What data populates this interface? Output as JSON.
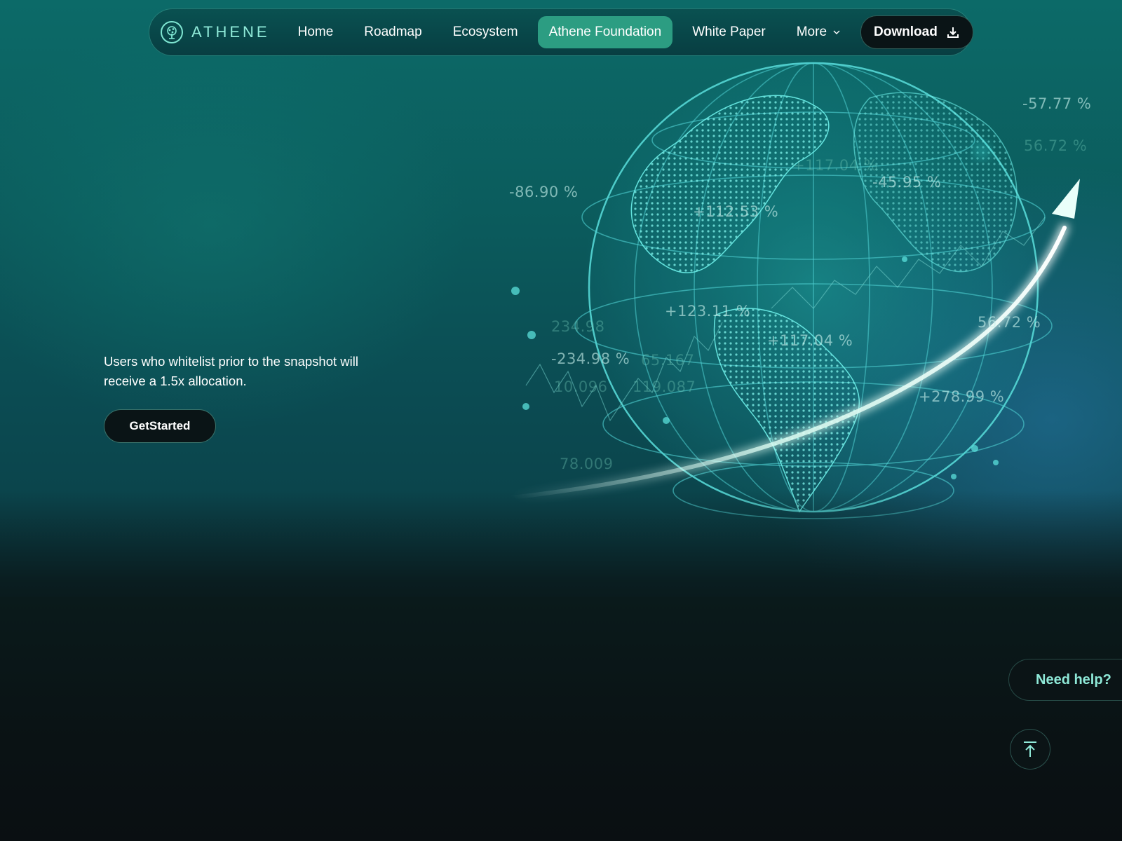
{
  "brand": {
    "name": "ATHENE"
  },
  "nav": {
    "items": [
      {
        "label": "Home"
      },
      {
        "label": "Roadmap"
      },
      {
        "label": "Ecosystem"
      },
      {
        "label": "Athene Foundation",
        "active": true
      },
      {
        "label": "White Paper"
      }
    ],
    "more_label": "More",
    "download_label": "Download"
  },
  "hero": {
    "tagline": "Users who whitelist prior to the snapshot will receive a 1.5x allocation.",
    "cta_label": "GetStarted"
  },
  "globe": {
    "stats": [
      {
        "text": "-57.77 %"
      },
      {
        "text": "-86.90 %"
      },
      {
        "text": "+117.04 %"
      },
      {
        "text": "-45.95 %"
      },
      {
        "text": "+112.53 %"
      },
      {
        "text": "+123.11 %"
      },
      {
        "text": "+117.04 %"
      },
      {
        "text": "56.72 %"
      },
      {
        "text": "-234.98 %"
      },
      {
        "text": "65.167"
      },
      {
        "text": "10.096"
      },
      {
        "text": "119.087"
      },
      {
        "text": "+278.99 %"
      },
      {
        "text": "78.009"
      },
      {
        "text": "234.98"
      },
      {
        "text": "56.72 %"
      }
    ]
  },
  "support": {
    "help_label": "Need help?"
  },
  "colors": {
    "accent": "#2c9d82",
    "mint": "#8fe9d8",
    "dark": "#0a1416"
  },
  "icons": {
    "logo": "athene-tree-icon",
    "more": "chevron-down-icon",
    "download": "download-icon",
    "to_top": "arrow-up-to-line-icon"
  }
}
